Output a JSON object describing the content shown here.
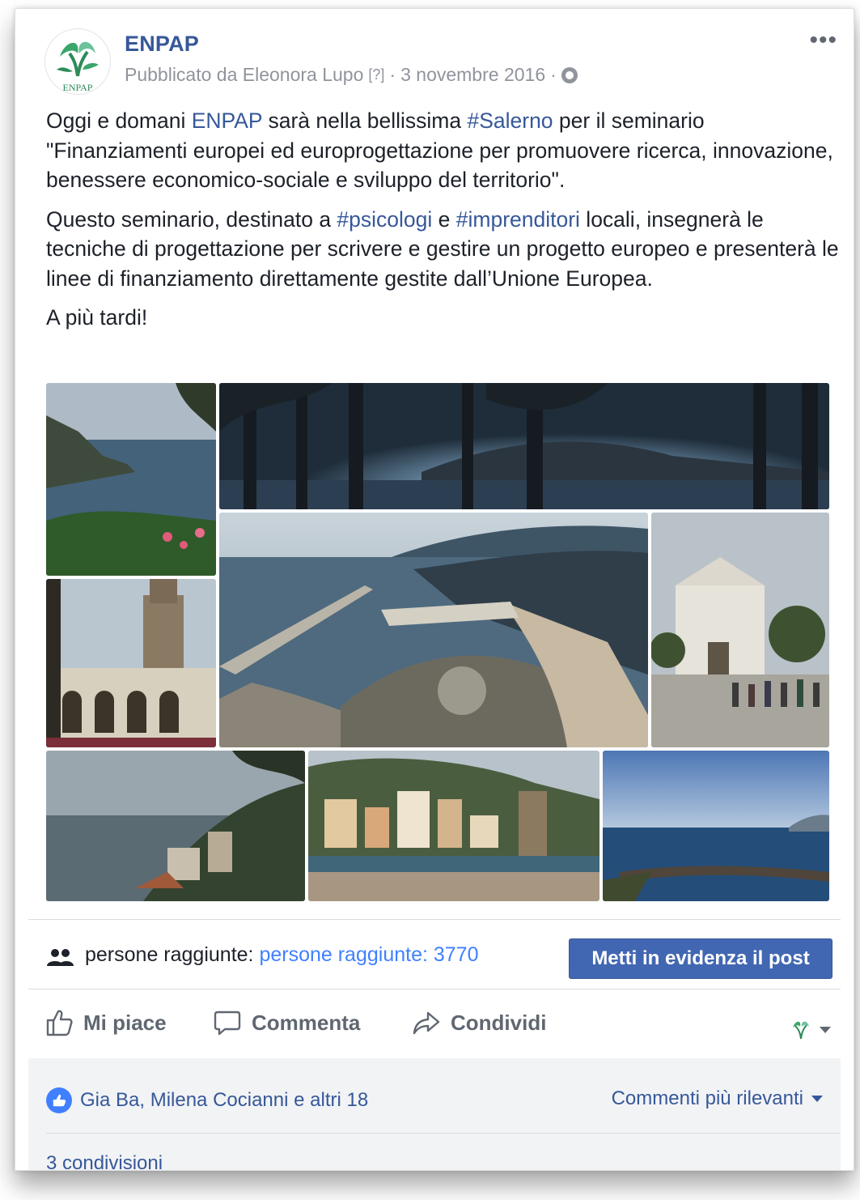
{
  "post": {
    "page_name": "ENPAP",
    "published_by": "Pubblicato da Eleonora Lupo",
    "help_marker": "[?]",
    "separator": "·",
    "date": "3 novembre 2016",
    "avatar_label": "ENPAP",
    "more_label": "•••"
  },
  "text": {
    "p1": [
      {
        "t": "Oggi e domani ",
        "link": false
      },
      {
        "t": "ENPAP",
        "link": true
      },
      {
        "t": " sarà nella bellissima ",
        "link": false
      },
      {
        "t": "#Salerno",
        "link": true
      },
      {
        "t": " per il seminario \"Finanziamenti europei ed europrogettazione per promuovere ricerca, innovazione, benessere economico-sociale e sviluppo del territorio\".",
        "link": false
      }
    ],
    "p2": [
      {
        "t": "Questo seminario, destinato a ",
        "link": false
      },
      {
        "t": "#psicologi",
        "link": true
      },
      {
        "t": " e ",
        "link": false
      },
      {
        "t": "#imprenditori",
        "link": true
      },
      {
        "t": " locali, insegnerà le tecniche di progettazione per scrivere e gestire un progetto europeo e presenterà le linee di finanziamento direttamente gestite dall’Unione Europea.",
        "link": false
      }
    ],
    "p3": "A più tardi!"
  },
  "reach": {
    "label": "persone raggiunte:",
    "link": "persone raggiunte: 3770",
    "boost_button": "Metti in evidenza il post"
  },
  "actions": {
    "like": "Mi piace",
    "comment": "Commenta",
    "share": "Condividi"
  },
  "feedback": {
    "likers": "Gia Ba, Milena Cocianni e altri 18",
    "sort": "Commenti più rilevanti",
    "shares": "3 condivisioni"
  },
  "colors": {
    "link": "#365899",
    "button": "#4267b2",
    "reach_link": "#4080ff"
  }
}
